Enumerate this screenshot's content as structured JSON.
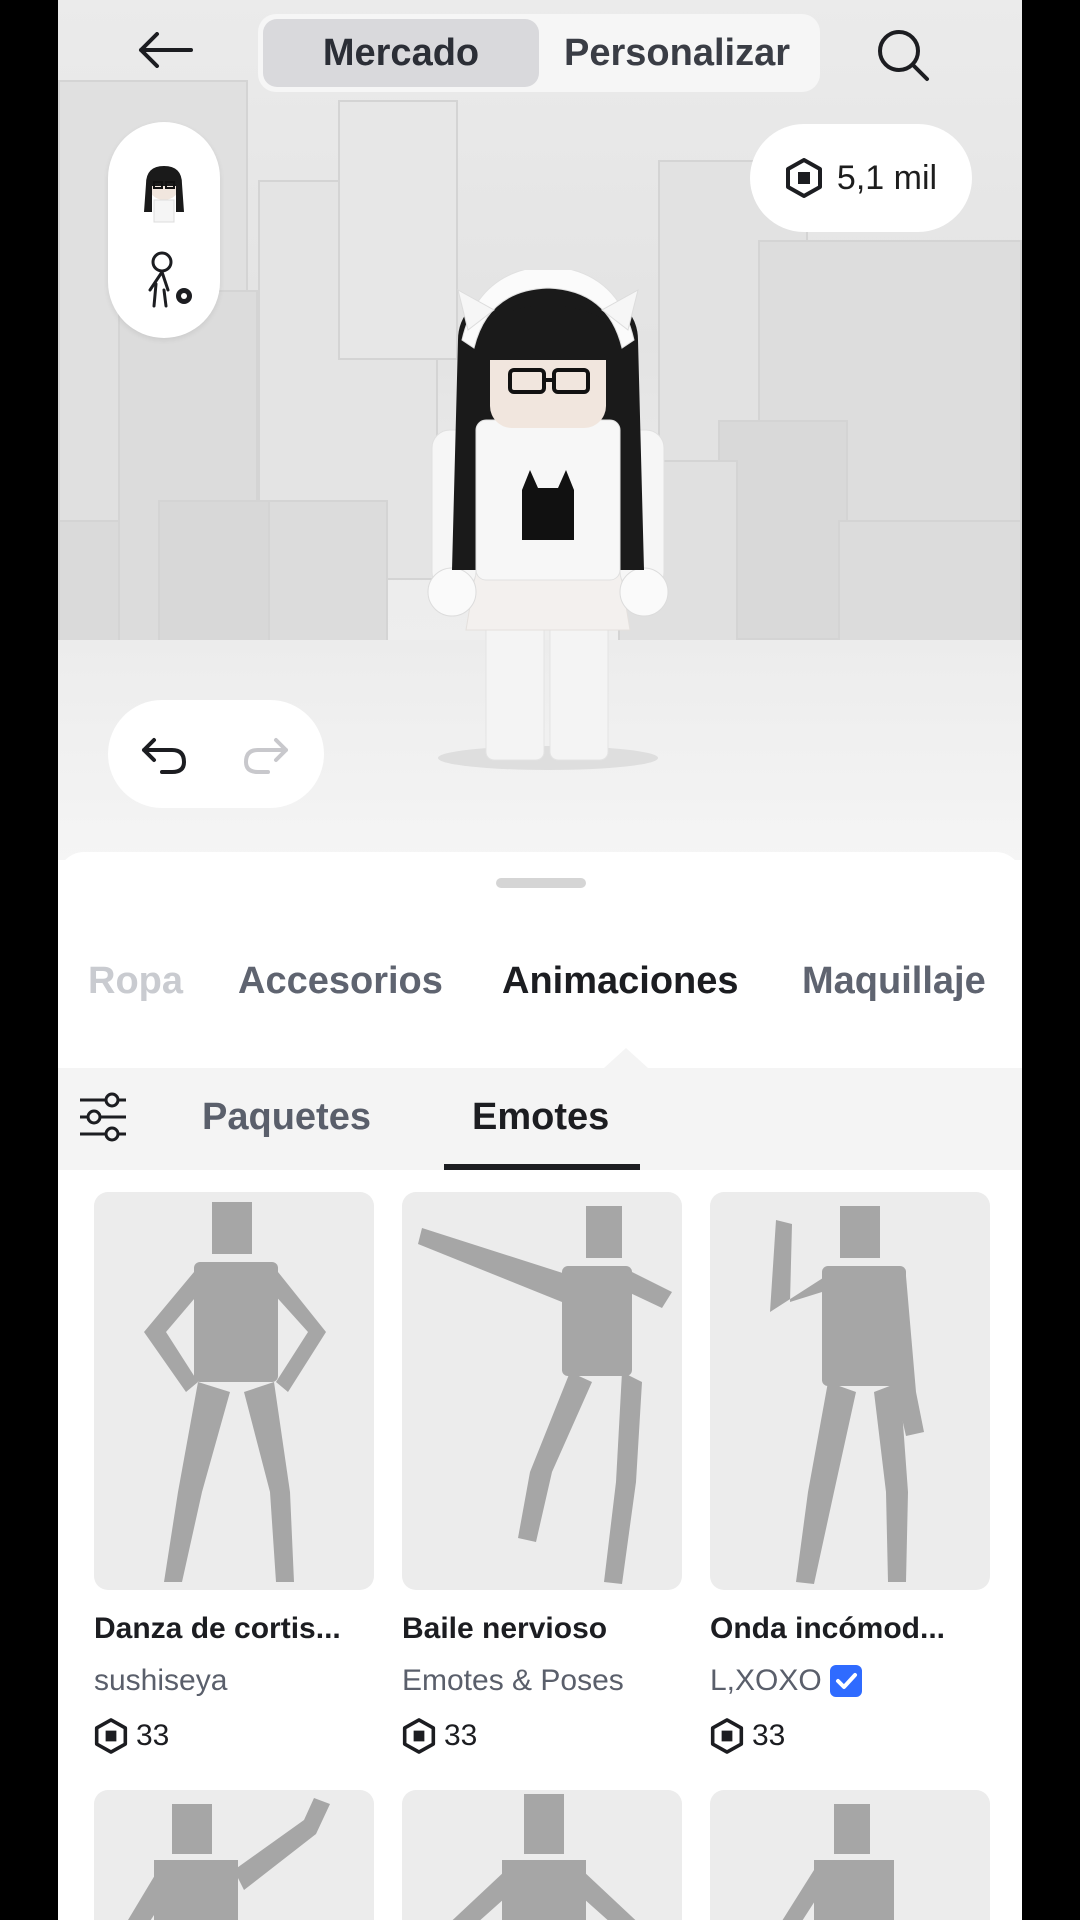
{
  "header": {
    "tabs": [
      {
        "label": "Mercado",
        "active": true
      },
      {
        "label": "Personalizar",
        "active": false
      }
    ]
  },
  "currency": {
    "amount": "5,1 mil",
    "icon": "robux-icon"
  },
  "categories": [
    {
      "label": "Ropa",
      "state": "faded"
    },
    {
      "label": "Accesorios",
      "state": "normal"
    },
    {
      "label": "Animaciones",
      "state": "active"
    },
    {
      "label": "Maquillaje",
      "state": "normal"
    }
  ],
  "subtabs": [
    {
      "label": "Paquetes",
      "active": false
    },
    {
      "label": "Emotes",
      "active": true
    }
  ],
  "items": [
    {
      "title": "Danza de cortis...",
      "creator": "sushiseya",
      "verified": false,
      "price": "33"
    },
    {
      "title": "Baile nervioso",
      "creator": "Emotes & Poses",
      "verified": false,
      "price": "33"
    },
    {
      "title": "Onda incómod...",
      "creator": "L,XOXO",
      "verified": true,
      "price": "33"
    }
  ],
  "colors": {
    "accent": "#1c1d21",
    "verified": "#2f6bff",
    "thumb_bg": "#ececec"
  }
}
